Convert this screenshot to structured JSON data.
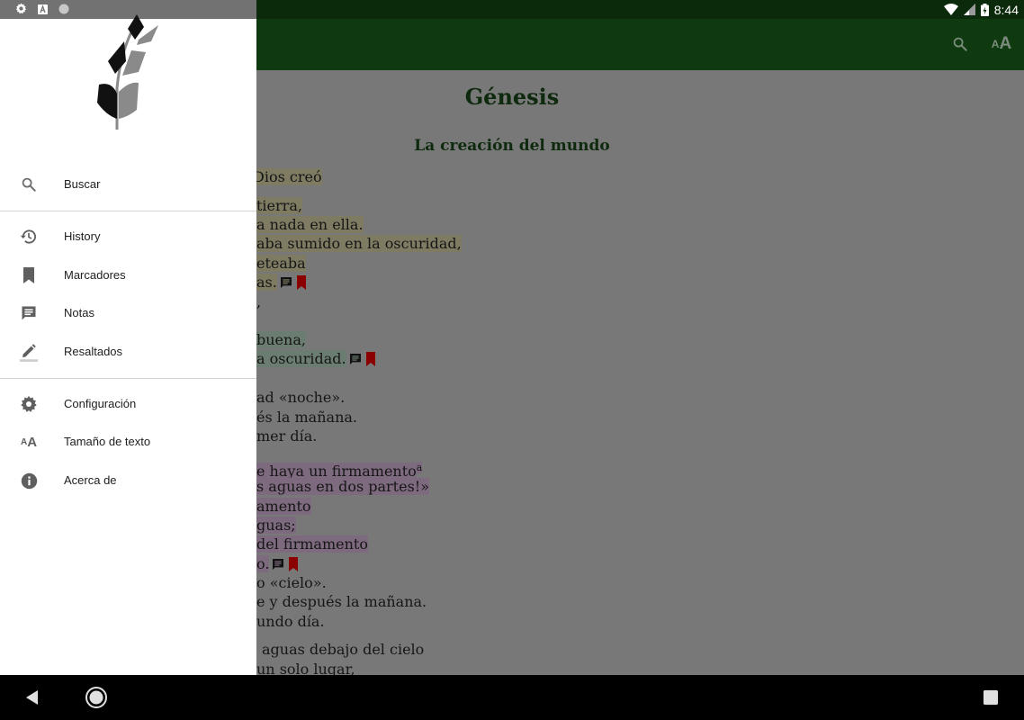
{
  "status_bar": {
    "time": "8:44",
    "icons": [
      "settings-icon",
      "a-badge-icon",
      "circle-icon",
      "wifi-icon",
      "signal-icon",
      "battery-icon"
    ]
  },
  "app_bar": {
    "actions": [
      "search-icon",
      "text-size-icon"
    ],
    "text_size_small": "A",
    "text_size_big": "A"
  },
  "content": {
    "book_title": "Génesis",
    "section_title": "La creación del mundo",
    "lines": [
      "Dios creó",
      "tierra,",
      "a nada en ella.",
      "aba sumido en la oscuridad,",
      "eteaba",
      "as.",
      ",",
      "buena,",
      "a oscuridad.",
      "ad «noche».",
      "és la mañana.",
      "mer día.",
      "e haya un firmamento",
      "s aguas en dos partes!»",
      "amento",
      "guas;",
      "del firmamento",
      "o.",
      "o «cielo».",
      "e y después la mañana.",
      "undo día.",
      "aguas debajo del cielo",
      "un solo lugar,"
    ],
    "footnote_marker": "a"
  },
  "drawer": {
    "menu": [
      {
        "label": "Buscar",
        "icon": "search-icon"
      },
      {
        "label": "History",
        "icon": "history-icon"
      },
      {
        "label": "Marcadores",
        "icon": "bookmark-icon"
      },
      {
        "label": "Notas",
        "icon": "note-icon"
      },
      {
        "label": "Resaltados",
        "icon": "highlighter-icon"
      },
      {
        "label": "Configuración",
        "icon": "gear-icon"
      },
      {
        "label": "Tamaño de texto",
        "icon": "text-size-icon"
      },
      {
        "label": "Acerca de",
        "icon": "info-icon"
      }
    ],
    "text_size_icon_small": "A",
    "text_size_icon_big": "A"
  },
  "colors": {
    "app_bar": "#0f3a10",
    "highlight_yellow": "#7e7b62",
    "highlight_green": "#6a7d70",
    "highlight_pink": "#7e6a7e",
    "bookmark": "#8b0000"
  }
}
